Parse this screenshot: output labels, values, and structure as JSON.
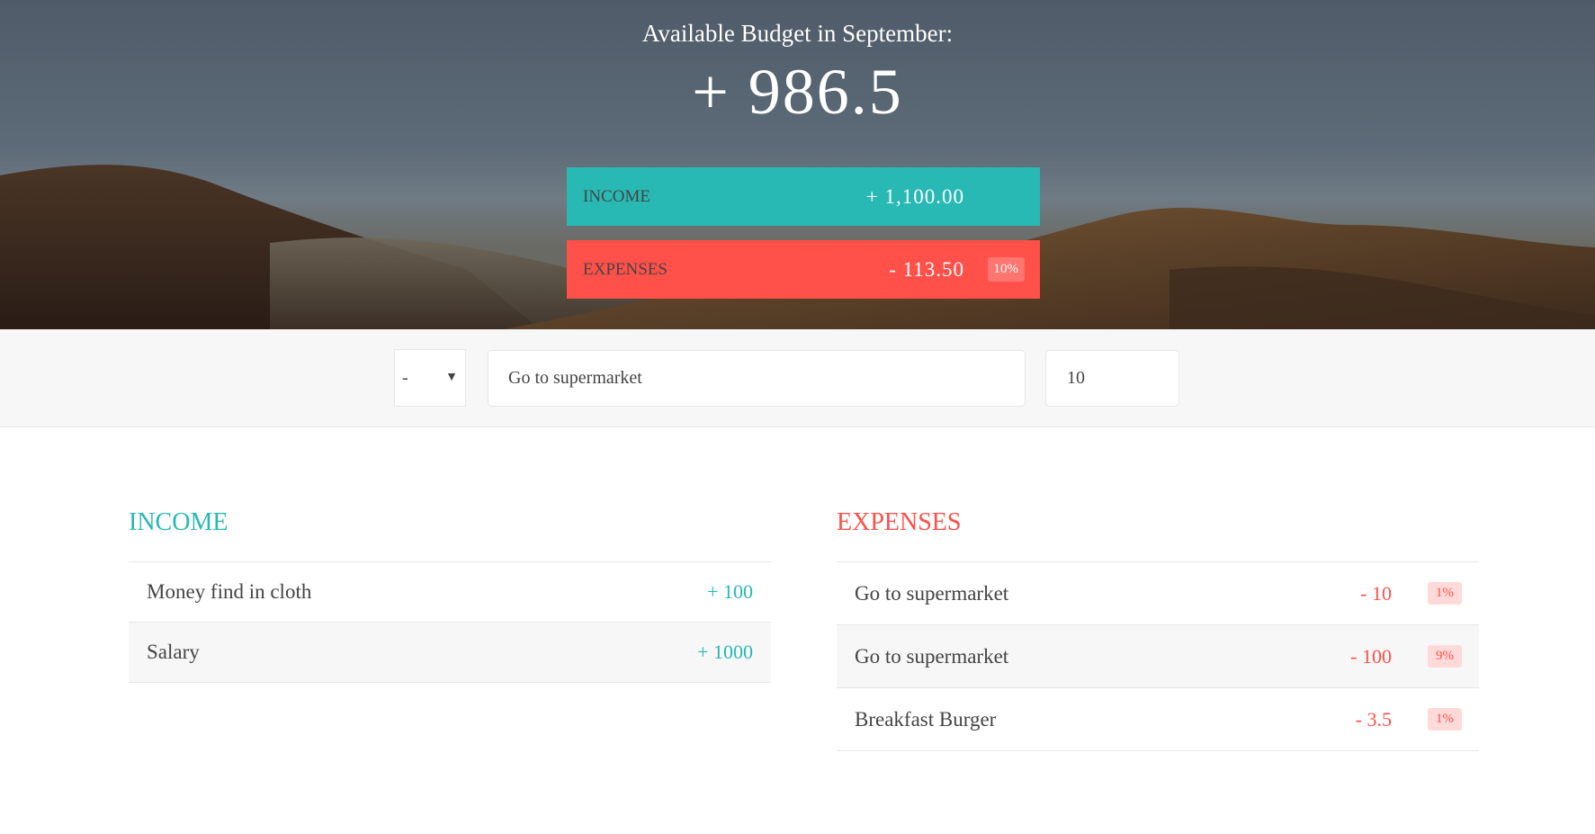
{
  "budget": {
    "title": "Available Budget in September:",
    "value": "+ 986.5",
    "income_label": "INCOME",
    "income_value": "+ 1,100.00",
    "expenses_label": "EXPENSES",
    "expenses_value": "- 113.50",
    "expenses_percentage": "10%"
  },
  "add": {
    "type_selected": "-",
    "description_value": "Go to supermarket",
    "value": "10"
  },
  "income": {
    "title": "INCOME",
    "items": [
      {
        "description": "Money find in cloth",
        "value": "+ 100"
      },
      {
        "description": "Salary",
        "value": "+ 1000"
      }
    ]
  },
  "expenses": {
    "title": "EXPENSES",
    "items": [
      {
        "description": "Go to supermarket",
        "value": "- 10",
        "percentage": "1%"
      },
      {
        "description": "Go to supermarket",
        "value": "- 100",
        "percentage": "9%"
      },
      {
        "description": "Breakfast Burger",
        "value": "- 3.5",
        "percentage": "1%"
      }
    ]
  },
  "colors": {
    "income": "#28b9b5",
    "expenses": "#ff5049",
    "sky": "#55636f",
    "hills": "#4a3424"
  }
}
